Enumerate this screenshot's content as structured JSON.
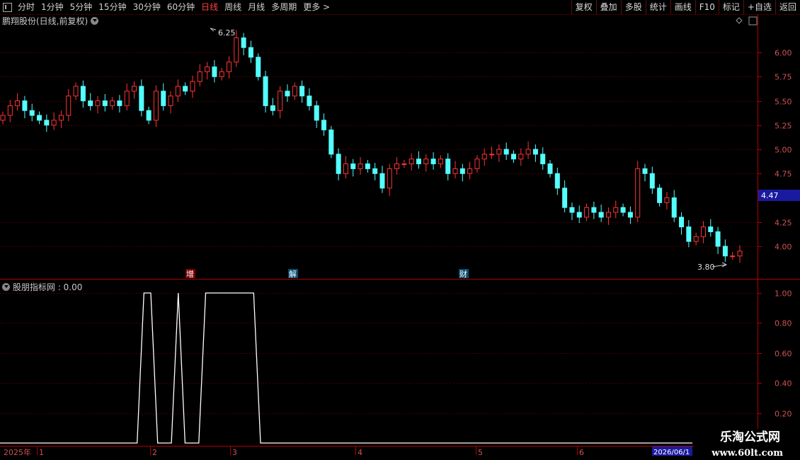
{
  "toolbar": {
    "periods": [
      "分时",
      "1分钟",
      "5分钟",
      "15分钟",
      "30分钟",
      "60分钟",
      "日线",
      "周线",
      "月线",
      "多周期",
      "更多 >"
    ],
    "active_period": "日线",
    "buttons": [
      "复权",
      "叠加",
      "多股",
      "统计",
      "画线",
      "F10",
      "标记",
      "+自选",
      "返回"
    ]
  },
  "main_panel": {
    "title": "鹏翔股份(日线,前复权)",
    "y_ticks": [
      "6.00",
      "5.75",
      "5.50",
      "5.25",
      "5.00",
      "4.75",
      "4.25",
      "4.00"
    ],
    "current_price": "4.47",
    "high_label": "6.25",
    "low_label": "3.80",
    "event_markers": [
      "增",
      "解",
      "财"
    ],
    "colors": {
      "up": "#ff3333",
      "down": "#54ffff",
      "axis": "#b00000",
      "grid": "#7a0000"
    }
  },
  "indicator_panel": {
    "title": "股朋指标网 : 0.00",
    "y_ticks": [
      "1.00",
      "0.80",
      "0.60",
      "0.40",
      "0.20"
    ]
  },
  "time_axis": {
    "labels": [
      "2025年",
      "1",
      "2",
      "3",
      "4",
      "5",
      "6"
    ],
    "end_date": "2026/06/1"
  },
  "watermark": {
    "line1": "乐淘公式网",
    "line2": "www.60lt.com"
  },
  "chart_data": [
    {
      "type": "candlestick",
      "title": "鹏翔股份(日线,前复权)",
      "y_range": [
        3.75,
        6.3
      ],
      "close_series": [
        5.35,
        5.45,
        5.5,
        5.4,
        5.35,
        5.3,
        5.25,
        5.3,
        5.35,
        5.55,
        5.65,
        5.5,
        5.45,
        5.5,
        5.45,
        5.5,
        5.45,
        5.6,
        5.65,
        5.4,
        5.3,
        5.6,
        5.45,
        5.55,
        5.65,
        5.6,
        5.7,
        5.8,
        5.85,
        5.75,
        5.8,
        5.9,
        6.15,
        6.05,
        5.95,
        5.75,
        5.45,
        5.4,
        5.6,
        5.55,
        5.65,
        5.55,
        5.45,
        5.3,
        5.2,
        4.95,
        4.75,
        4.85,
        4.8,
        4.85,
        4.8,
        4.75,
        4.6,
        4.8,
        4.85,
        4.85,
        4.9,
        4.85,
        4.9,
        4.85,
        4.9,
        4.75,
        4.8,
        4.75,
        4.8,
        4.9,
        4.95,
        4.95,
        5.0,
        4.95,
        4.9,
        4.95,
        5.0,
        4.95,
        4.85,
        4.75,
        4.6,
        4.4,
        4.35,
        4.3,
        4.4,
        4.35,
        4.3,
        4.35,
        4.4,
        4.35,
        4.3,
        4.8,
        4.75,
        4.6,
        4.45,
        4.5,
        4.3,
        4.2,
        4.05,
        4.1,
        4.2,
        4.15,
        4.0,
        3.9,
        3.9,
        3.95
      ],
      "high": 6.25,
      "low": 3.8
    },
    {
      "type": "line",
      "title": "股朋指标网",
      "y_range": [
        0,
        1.05
      ],
      "values": [
        0,
        0,
        0,
        0,
        0,
        0,
        0,
        0,
        0,
        0,
        0,
        0,
        0,
        0,
        0,
        0,
        0,
        0,
        0,
        0,
        0,
        1,
        1,
        0,
        0,
        0,
        1,
        0,
        0,
        0,
        1,
        1,
        1,
        1,
        1,
        1,
        1,
        1,
        0,
        0,
        0,
        0,
        0,
        0,
        0,
        0,
        0,
        0,
        0,
        0,
        0,
        0,
        0,
        0,
        0,
        0,
        0,
        0,
        0,
        0,
        0,
        0,
        0,
        0,
        0,
        0,
        0,
        0,
        0,
        0,
        0,
        0,
        0,
        0,
        0,
        0,
        0,
        0,
        0,
        0,
        0,
        0,
        0,
        0,
        0,
        0,
        0,
        0,
        0,
        0,
        0,
        0,
        0,
        0,
        0,
        0,
        0,
        0,
        0,
        0,
        0,
        0
      ]
    }
  ]
}
